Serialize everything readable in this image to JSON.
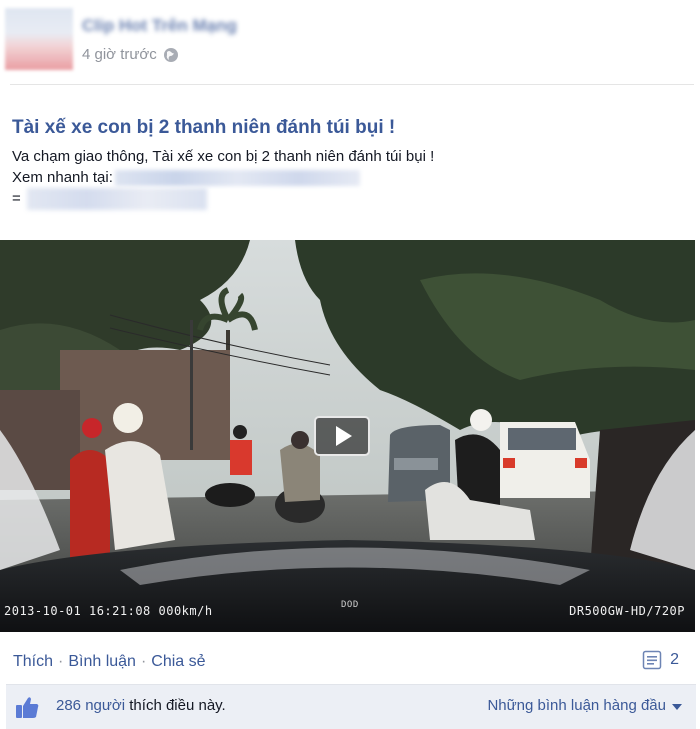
{
  "post": {
    "page_name": "Clip Hot Trên Mạng",
    "timestamp": "4 giờ trước",
    "title": "Tài xế xe con bị 2 thanh niên đánh túi bụi !",
    "body_line1": "Va chạm giao thông, Tài xế xe con bị 2 thanh niên đánh túi bụi !",
    "body_line2_prefix": "Xem nhanh tại:",
    "body_line3_prefix": "="
  },
  "video": {
    "osd_datetime": "2013-10-01  16:21:08   000km/h",
    "osd_model": "DR500GW-HD/720P",
    "osd_brand": "DOD"
  },
  "actions": {
    "like": "Thích",
    "comment": "Bình luận",
    "share": "Chia sẻ",
    "separator": "·",
    "comment_count": "2"
  },
  "likes": {
    "count_text": "286 người",
    "suffix_text": " thích điều này.",
    "top_comments": "Những bình luận hàng đầu"
  },
  "colors": {
    "link": "#3b5998",
    "footer_bg": "#eceff5"
  },
  "icons": [
    "globe-icon",
    "play-icon",
    "comment-icon",
    "like-thumb-icon",
    "caret-down-icon"
  ]
}
